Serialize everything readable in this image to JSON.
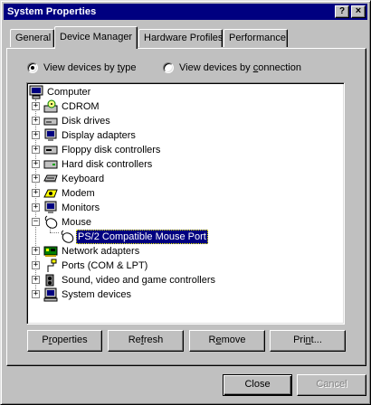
{
  "window": {
    "title": "System Properties",
    "help_label": "?",
    "close_label": "×"
  },
  "tabs": [
    {
      "label": "General",
      "active": false
    },
    {
      "label": "Device Manager",
      "active": true
    },
    {
      "label": "Hardware Profiles",
      "active": false
    },
    {
      "label": "Performance",
      "active": false
    }
  ],
  "view_options": {
    "by_type_prefix": "View devices by ",
    "by_type_key": "t",
    "by_type_suffix": "ype",
    "by_type_checked": true,
    "by_connection_prefix": "View devices by ",
    "by_connection_key": "c",
    "by_connection_suffix": "onnection",
    "by_connection_checked": false
  },
  "tree": {
    "root": "Computer",
    "items": [
      {
        "label": "CDROM",
        "icon": "cdrom-icon",
        "expanded": false
      },
      {
        "label": "Disk drives",
        "icon": "disk-drive-icon",
        "expanded": false
      },
      {
        "label": "Display adapters",
        "icon": "monitor-icon",
        "expanded": false
      },
      {
        "label": "Floppy disk controllers",
        "icon": "floppy-controller-icon",
        "expanded": false
      },
      {
        "label": "Hard disk controllers",
        "icon": "hard-disk-controller-icon",
        "expanded": false
      },
      {
        "label": "Keyboard",
        "icon": "keyboard-icon",
        "expanded": false
      },
      {
        "label": "Modem",
        "icon": "modem-icon",
        "expanded": false
      },
      {
        "label": "Monitors",
        "icon": "monitor-icon",
        "expanded": false
      },
      {
        "label": "Mouse",
        "icon": "mouse-icon",
        "expanded": true
      },
      {
        "label": "PS/2 Compatible Mouse Port",
        "icon": "mouse-icon",
        "child": true,
        "selected": true
      },
      {
        "label": "Network adapters",
        "icon": "network-adapter-icon",
        "expanded": false
      },
      {
        "label": "Ports (COM & LPT)",
        "icon": "port-icon",
        "expanded": false
      },
      {
        "label": "Sound, video and game controllers",
        "icon": "sound-icon",
        "expanded": false
      },
      {
        "label": "System devices",
        "icon": "system-devices-icon",
        "expanded": false
      }
    ]
  },
  "actions": {
    "properties_key": "r",
    "properties_pre": "P",
    "properties_post": "operties",
    "refresh_key": "f",
    "refresh_pre": "Re",
    "refresh_post": "resh",
    "remove_key": "e",
    "remove_pre": "R",
    "remove_post": "move",
    "print_key": "n",
    "print_pre": "Pri",
    "print_post": "t..."
  },
  "footer": {
    "close_label": "Close",
    "cancel_label": "Cancel"
  },
  "colors": {
    "selection": "#000080",
    "titlebar": "#000080",
    "face": "#c0c0c0"
  }
}
